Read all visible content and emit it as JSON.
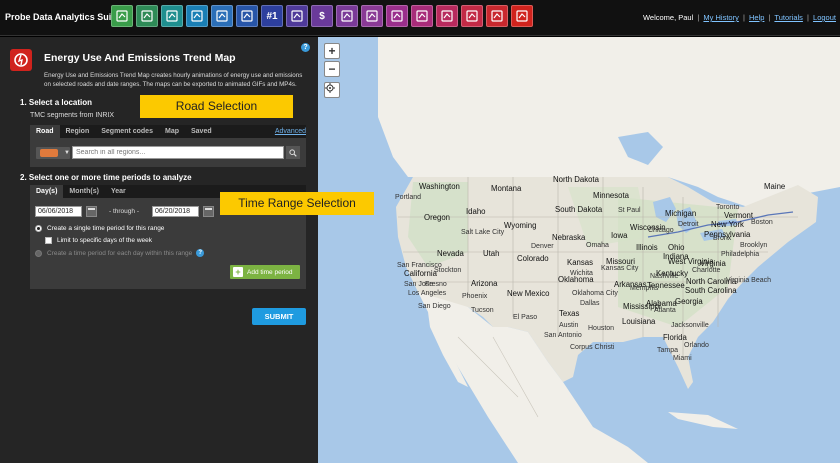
{
  "app": {
    "title": "Probe Data Analytics Suite"
  },
  "toolbar": {
    "tools": [
      {
        "icon": "magnifier-tool-icon",
        "color": "#3a9d4a",
        "text": ""
      },
      {
        "icon": "download-tool-icon",
        "color": "#2e8b57",
        "text": ""
      },
      {
        "icon": "filmstrip-tool-icon",
        "color": "#1f8f8f",
        "text": ""
      },
      {
        "icon": "play-tool-icon",
        "color": "#1a7fb5",
        "text": ""
      },
      {
        "icon": "trend-line-tool-icon",
        "color": "#2b6fb8",
        "text": ""
      },
      {
        "icon": "list-tool-icon",
        "color": "#2755a8",
        "text": ""
      },
      {
        "icon": "ranking-tool-icon",
        "color": "#2d3f9e",
        "text": "#1"
      },
      {
        "icon": "bar-chart-tool-icon",
        "color": "#4f3a9a",
        "text": ""
      },
      {
        "icon": "dollar-tool-icon",
        "color": "#6a3a9a",
        "text": "$"
      },
      {
        "icon": "calculator-tool-icon",
        "color": "#7a3a98",
        "text": ""
      },
      {
        "icon": "us-map-tool-icon",
        "color": "#8a3a96",
        "text": ""
      },
      {
        "icon": "network-tool-icon",
        "color": "#9a2f8c",
        "text": ""
      },
      {
        "icon": "document-tool-icon",
        "color": "#a82c7a",
        "text": ""
      },
      {
        "icon": "clock-tool-icon",
        "color": "#b82a5e",
        "text": ""
      },
      {
        "icon": "bus-tool-icon",
        "color": "#c22a46",
        "text": ""
      },
      {
        "icon": "grid-tool-icon",
        "color": "#c8282e",
        "text": ""
      },
      {
        "icon": "energy-tool-icon",
        "color": "#d0231d",
        "text": ""
      }
    ]
  },
  "user": {
    "welcome": "Welcome, Paul",
    "links": [
      "My History",
      "Help",
      "Tutorials",
      "Logout"
    ]
  },
  "panel": {
    "title": "Energy Use And Emissions Trend Map",
    "description": "Energy Use and Emissions Trend Map creates hourly animations of energy use and emissions on selected roads and date ranges. The maps can be exported to animated GIFs and MP4s.",
    "step1": "1. Select a location",
    "tmc": "TMC segments from  INRIX",
    "road_callout": "Road Selection",
    "location_tabs": [
      "Road",
      "Region",
      "Segment codes",
      "Map",
      "Saved"
    ],
    "advanced": "Advanced",
    "search_placeholder": "Search in all regions...",
    "step2": "2. Select one or more time periods to analyze",
    "time_tabs": [
      "Day(s)",
      "Month(s)",
      "Year"
    ],
    "start_date": "06/06/2018",
    "through": "- through -",
    "end_date": "06/20/2018",
    "opt_single": "Create a single time period for this range",
    "opt_limit": "Limit to specific days of the week",
    "opt_each": "Create a time period for each day within this range",
    "add_period": "Add time period",
    "time_callout": "Time Range Selection",
    "submit": "SUBMIT"
  },
  "map": {
    "zoom_in": "+",
    "zoom_out": "−",
    "states": [
      "Washington",
      "Oregon",
      "Montana",
      "Idaho",
      "Wyoming",
      "Nevada",
      "Utah",
      "Colorado",
      "California",
      "Arizona",
      "New Mexico",
      "North Dakota",
      "South Dakota",
      "Nebraska",
      "Kansas",
      "Oklahoma",
      "Texas",
      "Minnesota",
      "Iowa",
      "Missouri",
      "Arkansas",
      "Louisiana",
      "Wisconsin",
      "Illinois",
      "Michigan",
      "Indiana",
      "Ohio",
      "Kentucky",
      "Tennessee",
      "Mississippi",
      "Alabama",
      "Georgia",
      "Florida",
      "South Carolina",
      "North Carolina",
      "Virginia",
      "West Virginia",
      "Pennsylvania",
      "New York",
      "Vermont",
      "Maine",
      "Virginia Beach"
    ],
    "cities": [
      "Portland",
      "Salt Lake City",
      "San Francisco",
      "San Jose",
      "Stockton",
      "Fresno",
      "Los Angeles",
      "San Diego",
      "Phoenix",
      "Tucson",
      "El Paso",
      "Denver",
      "Omaha",
      "Kansas City",
      "Wichita",
      "Oklahoma City",
      "Dallas",
      "Austin",
      "Houston",
      "San Antonio",
      "Corpus Christi",
      "Memphis",
      "Nashville",
      "Atlanta",
      "Jacksonville",
      "Orlando",
      "Tampa",
      "Miami",
      "St Paul",
      "Chicago",
      "Detroit",
      "Toronto",
      "Boston",
      "Bronx",
      "Brooklyn",
      "Philadelphia",
      "Charlotte"
    ]
  }
}
